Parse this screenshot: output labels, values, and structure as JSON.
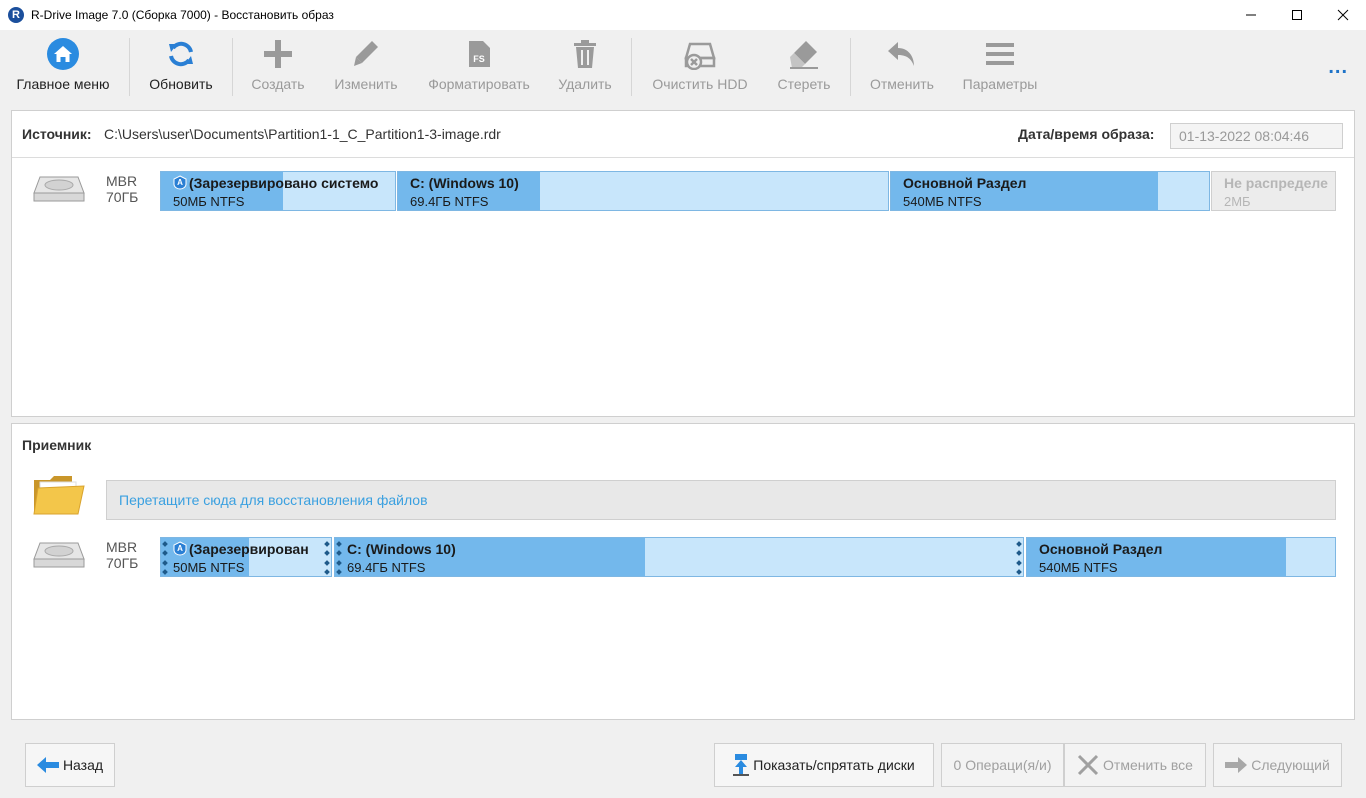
{
  "window": {
    "title": "R-Drive Image 7.0 (Сборка 7000) - Восстановить образ",
    "app_icon_letter": "R"
  },
  "toolbar": {
    "buttons": [
      {
        "label": "Главное меню",
        "icon": "home-icon",
        "enabled": true
      },
      {
        "label": "Обновить",
        "icon": "refresh-icon",
        "enabled": true
      },
      {
        "label": "Создать",
        "icon": "plus-icon",
        "enabled": false
      },
      {
        "label": "Изменить",
        "icon": "pencil-icon",
        "enabled": false
      },
      {
        "label": "Форматировать",
        "icon": "format-fs-icon",
        "enabled": false
      },
      {
        "label": "Удалить",
        "icon": "trash-icon",
        "enabled": false
      },
      {
        "label": "Очистить HDD",
        "icon": "wipe-hdd-icon",
        "enabled": false
      },
      {
        "label": "Стереть",
        "icon": "eraser-icon",
        "enabled": false
      },
      {
        "label": "Отменить",
        "icon": "undo-icon",
        "enabled": false
      },
      {
        "label": "Параметры",
        "icon": "menu-lines-icon",
        "enabled": false
      }
    ],
    "more": "..."
  },
  "source": {
    "label": "Источник:",
    "path": "C:\\Users\\user\\Documents\\Partition1-1_C_Partition1-3-image.rdr",
    "datetime_label": "Дата/время образа:",
    "datetime_value": "01-13-2022 08:04:46",
    "disk": {
      "scheme": "MBR",
      "size": "70ГБ",
      "partitions": [
        {
          "name": "(Зарезервировано системо",
          "info": "50МБ NTFS",
          "used": 0.52,
          "system": true
        },
        {
          "name": "C: (Windows 10)",
          "info": "69.4ГБ NTFS",
          "used": 0.29
        },
        {
          "name": "Основной Раздел",
          "info": "540МБ NTFS",
          "used": 0.84
        },
        {
          "name": "Не распределе",
          "info": "2МБ",
          "unallocated": true
        }
      ]
    }
  },
  "target": {
    "label": "Приемник",
    "drop_hint": "Перетащите сюда для восстановления файлов",
    "disk": {
      "scheme": "MBR",
      "size": "70ГБ",
      "partitions": [
        {
          "name": "(Зарезервирован",
          "info": "50МБ NTFS",
          "used": 0.52,
          "system": true
        },
        {
          "name": "C: (Windows 10)",
          "info": "69.4ГБ NTFS",
          "used": 0.45
        },
        {
          "name": "Основной Раздел",
          "info": "540МБ NTFS",
          "used": 0.84
        }
      ]
    }
  },
  "footer": {
    "back": "Назад",
    "show_hide_disks": "Показать/спрятать диски",
    "operations": "0 Операци(я/и)",
    "cancel_all": "Отменить все",
    "next": "Следующий"
  },
  "colors": {
    "accent": "#1e73c8",
    "partition_used": "#73b8ec",
    "partition_free": "#c8e6fb",
    "disabled_text": "#9a9a9a"
  }
}
